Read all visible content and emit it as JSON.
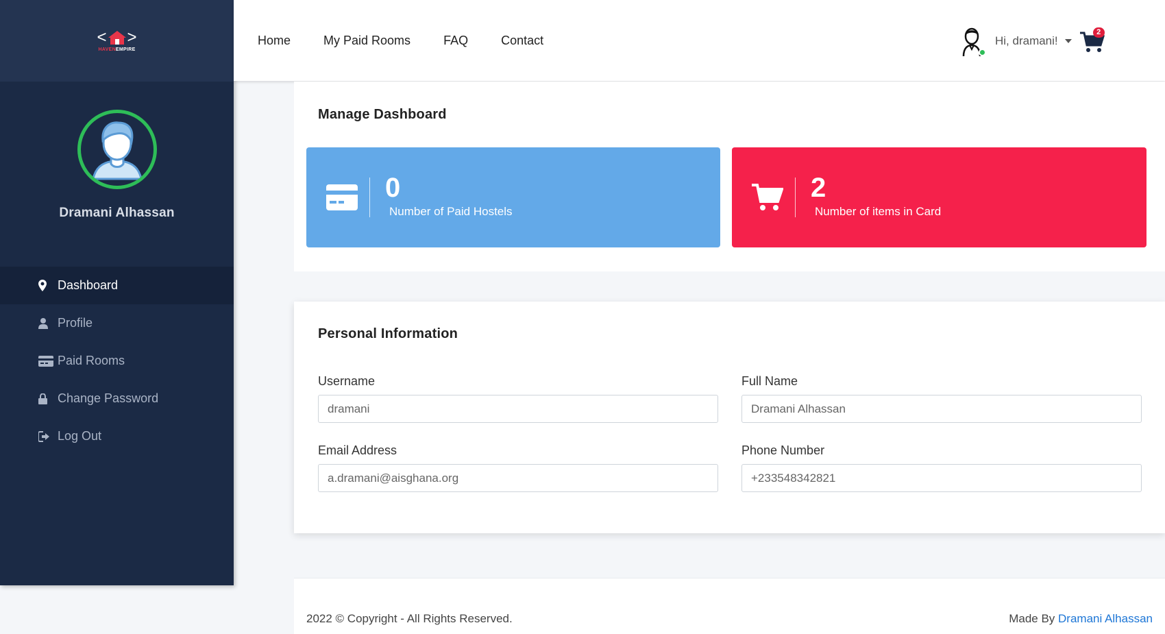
{
  "brand": {
    "logo_text_1": "HAVEN",
    "logo_text_2": "EMPIRE",
    "accent": "#e8354a"
  },
  "sidebar": {
    "profile_name": "Dramani Alhassan",
    "items": [
      {
        "label": "Dashboard",
        "icon": "map-marker-icon",
        "active": true
      },
      {
        "label": "Profile",
        "icon": "user-icon",
        "active": false
      },
      {
        "label": "Paid Rooms",
        "icon": "credit-card-icon",
        "active": false
      },
      {
        "label": "Change Password",
        "icon": "lock-icon",
        "active": false
      },
      {
        "label": "Log Out",
        "icon": "sign-out-icon",
        "active": false
      }
    ]
  },
  "topnav": {
    "links": [
      "Home",
      "My Paid Rooms",
      "FAQ",
      "Contact"
    ],
    "greeting": "Hi, dramani!",
    "cart_count": "2"
  },
  "dashboard": {
    "title": "Manage Dashboard",
    "cards": [
      {
        "value": "0",
        "label": "Number of Paid Hostels",
        "icon": "credit-card-icon",
        "color": "#63a9e8"
      },
      {
        "value": "2",
        "label": "Number of items in Card",
        "icon": "shopping-cart-icon",
        "color": "#f5214b"
      }
    ]
  },
  "personal_info": {
    "title": "Personal Information",
    "fields": {
      "username": {
        "label": "Username",
        "value": "dramani"
      },
      "full_name": {
        "label": "Full Name",
        "value": "Dramani Alhassan"
      },
      "email": {
        "label": "Email Address",
        "value": "a.dramani@aisghana.org"
      },
      "phone": {
        "label": "Phone Number",
        "value": "+233548342821"
      }
    }
  },
  "footer": {
    "copyright": "2022 © Copyright - All Rights Reserved.",
    "made_by_prefix": "Made By ",
    "made_by_name": "Dramani Alhassan"
  }
}
